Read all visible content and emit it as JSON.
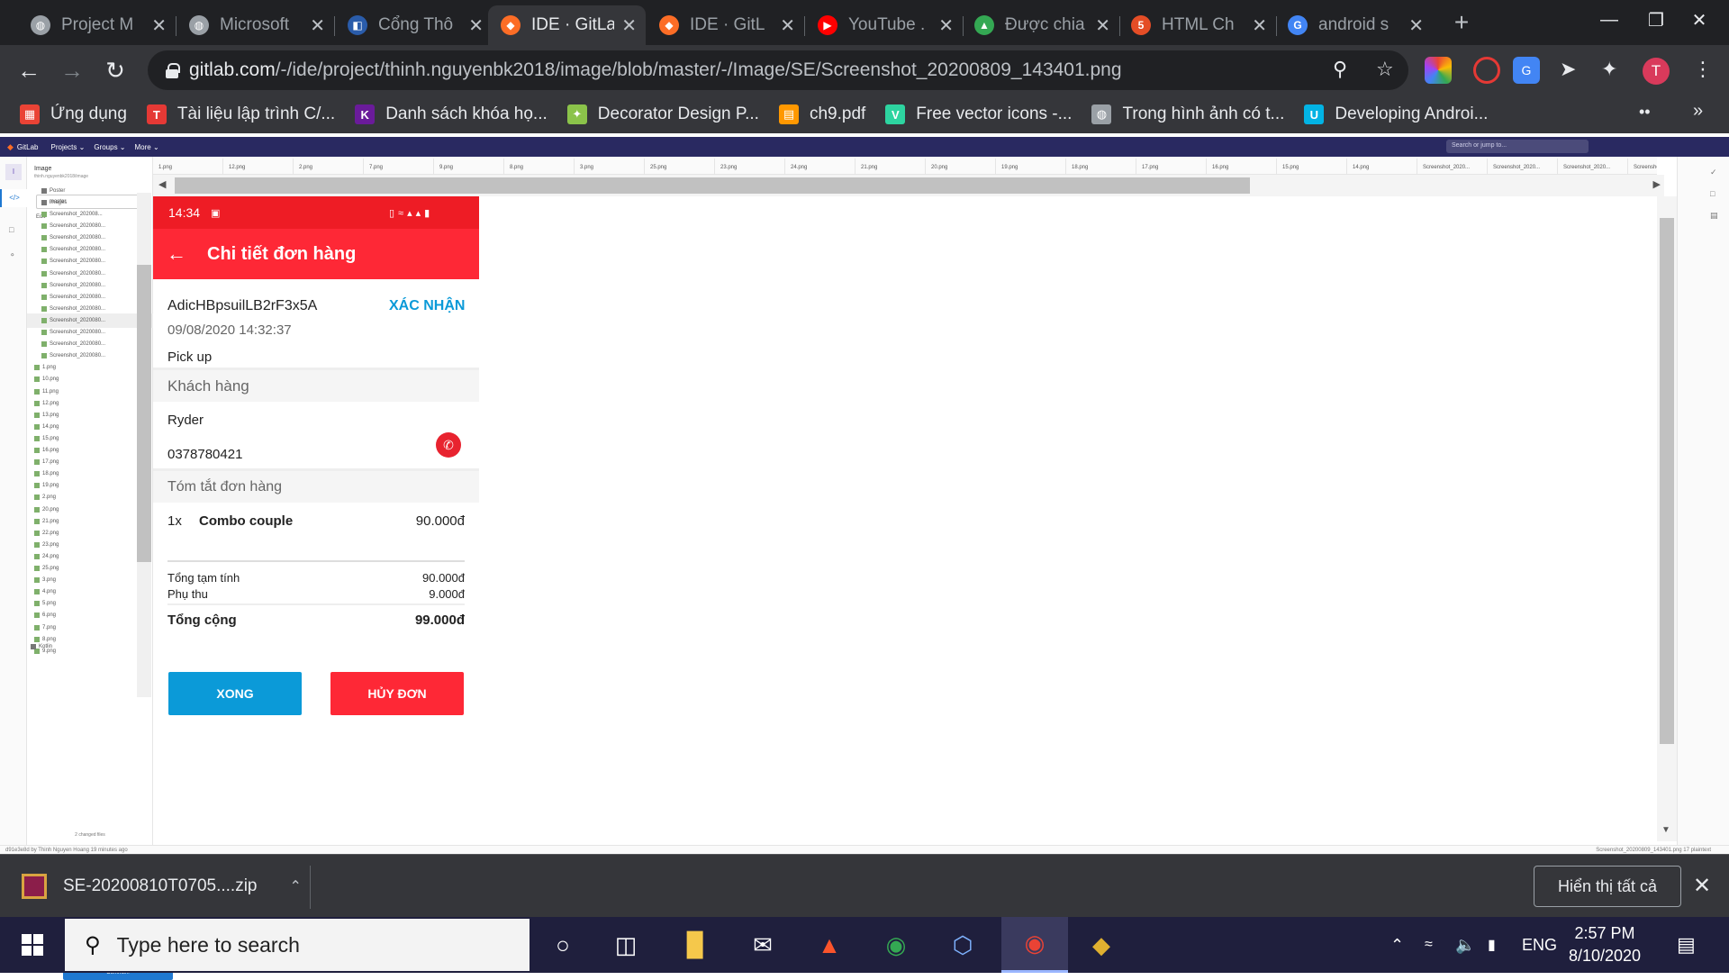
{
  "browser": {
    "tabs": [
      {
        "title": "Project M",
        "favicon": "globe-icon",
        "color": "#9aa0a6",
        "active": false
      },
      {
        "title": "Microsoft",
        "favicon": "globe-icon",
        "color": "#9aa0a6",
        "active": false
      },
      {
        "title": "Cổng Thô",
        "favicon": "university-icon",
        "color": "#2a5caa",
        "active": false
      },
      {
        "title": "IDE · GitLa",
        "favicon": "gitlab-icon",
        "color": "#fc6d26",
        "active": true
      },
      {
        "title": "IDE · GitL",
        "favicon": "gitlab-icon",
        "color": "#fc6d26",
        "active": false
      },
      {
        "title": "YouTube .",
        "favicon": "youtube-icon",
        "color": "#ff0000",
        "active": false
      },
      {
        "title": "Được chia",
        "favicon": "drive-icon",
        "color": "#34a853",
        "active": false
      },
      {
        "title": "HTML Ch",
        "favicon": "html5-icon",
        "color": "#e44d26",
        "active": false
      },
      {
        "title": "android s",
        "favicon": "google-icon",
        "color": "#4285f4",
        "active": false
      }
    ],
    "url_host": "gitlab.com",
    "url_path": "/-/ide/project/thinh.nguyenbk2018/image/blob/master/-/Image/SE/Screenshot_20200809_143401.png",
    "profile_initial": "T",
    "bookmarks": [
      {
        "label": "Ứng dụng",
        "icon": "apps-icon",
        "color": "#ea4335"
      },
      {
        "label": "Tài liệu lập trình C/...",
        "icon": "t-logo-icon",
        "color": "#e53935"
      },
      {
        "label": "Danh sách khóa họ...",
        "icon": "k-logo-icon",
        "color": "#6a1b9a"
      },
      {
        "label": "Decorator Design P...",
        "icon": "refactoring-icon",
        "color": "#8bc34a"
      },
      {
        "label": "ch9.pdf",
        "icon": "pdf-color-icon",
        "color": "#ff9800"
      },
      {
        "label": "Free vector icons -...",
        "icon": "vector-icon",
        "color": "#2dd4a0"
      },
      {
        "label": "Trong hình ảnh có t...",
        "icon": "globe-icon",
        "color": "#9aa0a6"
      },
      {
        "label": "Developing Androi...",
        "icon": "udacity-icon",
        "color": "#02b3e4"
      }
    ]
  },
  "gitlab": {
    "project_name": "Image",
    "project_path": "thinh.nguyenbk2018/image",
    "branch": "master",
    "edit_label": "Edit",
    "nav_items": [
      "GitLab",
      "Projects ⌄",
      "Groups ⌄",
      "More ⌄"
    ],
    "search_placeholder": "Search or jump to...",
    "tree_folders": [
      "Poster",
      "images"
    ],
    "tree_files": [
      "Screenshot_202008...",
      "Screenshot_2020080...",
      "Screenshot_2020080...",
      "Screenshot_2020080...",
      "Screenshot_2020080...",
      "Screenshot_2020080...",
      "Screenshot_2020080...",
      "Screenshot_2020080...",
      "Screenshot_2020080...",
      "Screenshot_2020080...",
      "Screenshot_2020080...",
      "Screenshot_2020080...",
      "Screenshot_2020080...",
      "1.png",
      "10.png",
      "11.png",
      "12.png",
      "13.png",
      "14.png",
      "15.png",
      "16.png",
      "17.png",
      "18.png",
      "19.png",
      "2.png",
      "20.png",
      "21.png",
      "22.png",
      "23.png",
      "24.png",
      "25.png",
      "3.png",
      "4.png",
      "5.png",
      "6.png",
      "7.png",
      "8.png",
      "9.png"
    ],
    "tree_last_folder": "Kotlin",
    "commit_label": "Commit...",
    "changed_files": "2 changed files",
    "file_tabs": [
      "1.png",
      "12.png",
      "2.png",
      "7.png",
      "9.png",
      "8.png",
      "3.png",
      "25.png",
      "23.png",
      "24.png",
      "21.png",
      "20.png",
      "19.png",
      "18.png",
      "17.png",
      "16.png",
      "15.png",
      "14.png",
      "Screenshot_2020...",
      "Screenshot_2020...",
      "Screenshot_2020...",
      "Screenshot_2020...",
      "Screenshot_2020...",
      "Screenshot_2020..."
    ],
    "status_left": "d91e3e8d by  Thinh Nguyen Hoang 19 minutes ago",
    "status_right": "Screenshot_20200809_143401.png   17   plaintext"
  },
  "phone": {
    "status_time": "14:34",
    "title": "Chi tiết đơn hàng",
    "order_id": "AdicHBpsuilLB2rF3x5A",
    "confirm_label": "XÁC NHẬN",
    "datetime": "09/08/2020 14:32:37",
    "order_type": "Pick up",
    "customer_section": "Khách hàng",
    "customer_name": "Ryder",
    "customer_phone": "0378780421",
    "summary_section": "Tóm tắt đơn hàng",
    "item": {
      "qty": "1x",
      "name": "Combo couple",
      "price": "90.000đ"
    },
    "subtotal_label": "Tổng tạm tính",
    "subtotal_value": "90.000đ",
    "fee_label": "Phụ thu",
    "fee_value": "9.000đ",
    "total_label": "Tổng cộng",
    "total_value": "99.000đ",
    "done_label": "XONG",
    "cancel_label": "HỦY ĐƠN",
    "colors": {
      "header": "#fe2836",
      "status": "#ee1c25",
      "done": "#0b9ad8",
      "cancel": "#fe2836",
      "confirm": "#0b9ad8"
    }
  },
  "downloads": {
    "file_name": "SE-20200810T0705....zip",
    "show_all_label": "Hiển thị tất cả"
  },
  "taskbar": {
    "search_placeholder": "Type here to search",
    "language": "ENG",
    "time": "2:57 PM",
    "date": "8/10/2020"
  }
}
